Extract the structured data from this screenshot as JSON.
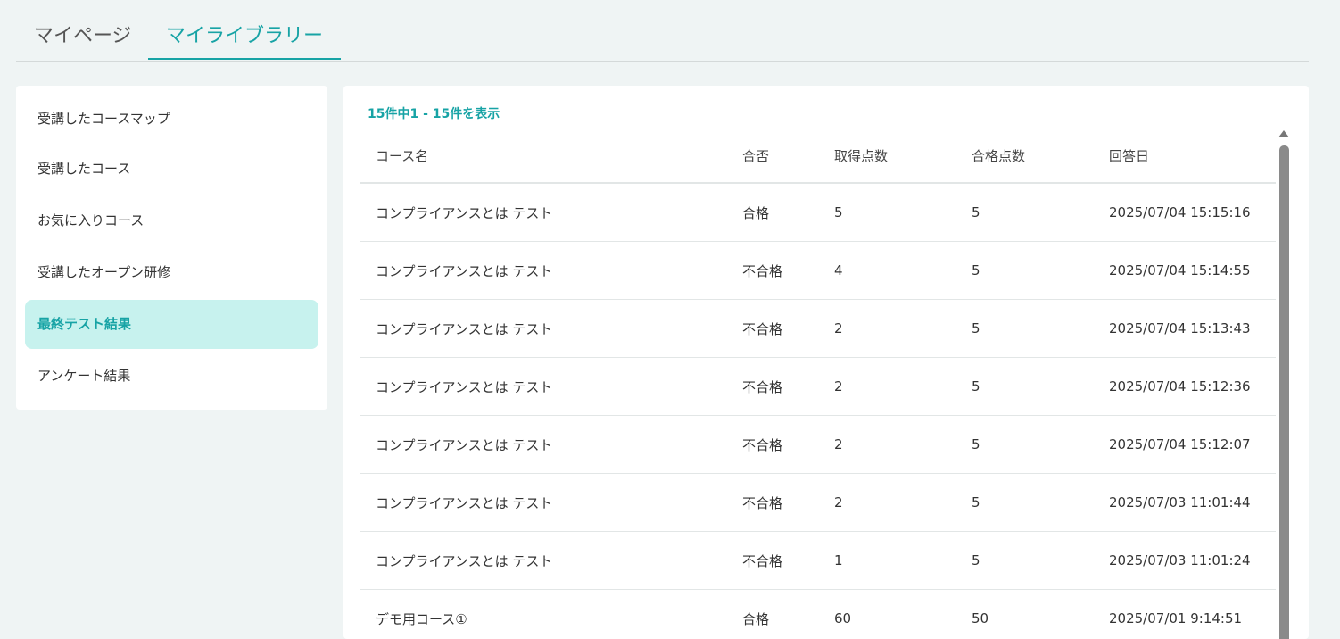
{
  "tabs": [
    {
      "label": "マイページ"
    },
    {
      "label": "マイライブラリー"
    }
  ],
  "sidebar": {
    "items": [
      {
        "label": "受講したコースマップ"
      },
      {
        "label": "受講したコース"
      },
      {
        "label": "お気に入りコース"
      },
      {
        "label": "受講したオープン研修"
      },
      {
        "label": "最終テスト結果"
      },
      {
        "label": "アンケート結果"
      }
    ]
  },
  "results": {
    "count_text": "15件中1 - 15件を表示",
    "columns": [
      "コース名",
      "合否",
      "取得点数",
      "合格点数",
      "回答日"
    ],
    "rows": [
      [
        "コンプライアンスとは テスト",
        "合格",
        "5",
        "5",
        "2025/07/04 15:15:16"
      ],
      [
        "コンプライアンスとは テスト",
        "不合格",
        "4",
        "5",
        "2025/07/04 15:14:55"
      ],
      [
        "コンプライアンスとは テスト",
        "不合格",
        "2",
        "5",
        "2025/07/04 15:13:43"
      ],
      [
        "コンプライアンスとは テスト",
        "不合格",
        "2",
        "5",
        "2025/07/04 15:12:36"
      ],
      [
        "コンプライアンスとは テスト",
        "不合格",
        "2",
        "5",
        "2025/07/04 15:12:07"
      ],
      [
        "コンプライアンスとは テスト",
        "不合格",
        "2",
        "5",
        "2025/07/03 11:01:44"
      ],
      [
        "コンプライアンスとは テスト",
        "不合格",
        "1",
        "5",
        "2025/07/03 11:01:24"
      ],
      [
        "デモ用コース①",
        "合格",
        "60",
        "50",
        "2025/07/01 9:14:51"
      ]
    ]
  },
  "colors": {
    "accent": "#17a3a5",
    "active_bg": "#c7f2ee",
    "page_bg": "#eff4f4"
  }
}
